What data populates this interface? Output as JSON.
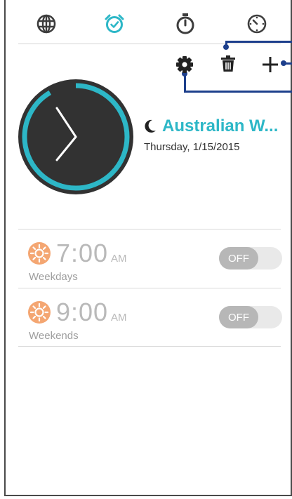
{
  "tabs": [
    {
      "name": "world-clock",
      "icon": "globe-icon",
      "active": false
    },
    {
      "name": "alarm",
      "icon": "alarm-clock-icon",
      "active": true
    },
    {
      "name": "stopwatch",
      "icon": "stopwatch-icon",
      "active": false
    },
    {
      "name": "timer",
      "icon": "timer-icon",
      "active": false
    }
  ],
  "actions": [
    {
      "name": "delete",
      "icon": "trash-icon"
    },
    {
      "name": "add",
      "icon": "plus-icon"
    },
    {
      "name": "settings",
      "icon": "gear-icon"
    }
  ],
  "clock": {
    "city": "Australian W...",
    "date": "Thursday, 1/15/2015",
    "day_night_icon": "moon-icon"
  },
  "alarms": [
    {
      "time": "7:00",
      "ampm": "AM",
      "label": "Weekdays",
      "toggle": "OFF",
      "icon": "sun-icon"
    },
    {
      "time": "9:00",
      "ampm": "AM",
      "label": "Weekends",
      "toggle": "OFF",
      "icon": "sun-icon"
    }
  ],
  "colors": {
    "accent": "#2db7c7",
    "callout": "#1d3f8c",
    "clock_face": "#333333",
    "sun": "#f4a672",
    "toggle_off": "#b7b7b7"
  }
}
